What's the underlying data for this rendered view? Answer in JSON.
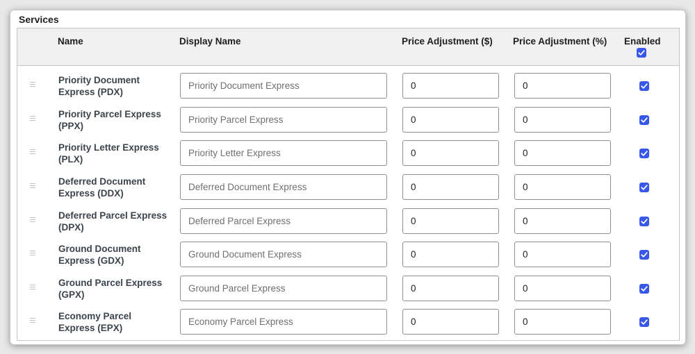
{
  "section": {
    "title": "Services"
  },
  "table": {
    "headers": {
      "name": "Name",
      "display_name": "Display Name",
      "price_adjustment": "Price Adjustment ($)",
      "price_adjustment_pct": "Price Adjustment (%)",
      "enabled": "Enabled"
    },
    "header_enabled_checked": true,
    "rows": [
      {
        "name": "Priority Document Express (PDX)",
        "display_placeholder": "Priority Document Express",
        "price": "0",
        "percent": "0",
        "enabled": true
      },
      {
        "name": "Priority Parcel Express (PPX)",
        "display_placeholder": "Priority Parcel Express",
        "price": "0",
        "percent": "0",
        "enabled": true
      },
      {
        "name": "Priority Letter Express (PLX)",
        "display_placeholder": "Priority Letter Express",
        "price": "0",
        "percent": "0",
        "enabled": true
      },
      {
        "name": "Deferred Document Express (DDX)",
        "display_placeholder": "Deferred Document Express",
        "price": "0",
        "percent": "0",
        "enabled": true
      },
      {
        "name": "Deferred Parcel Express (DPX)",
        "display_placeholder": "Deferred Parcel Express",
        "price": "0",
        "percent": "0",
        "enabled": true
      },
      {
        "name": "Ground Document Express (GDX)",
        "display_placeholder": "Ground Document Express",
        "price": "0",
        "percent": "0",
        "enabled": true
      },
      {
        "name": "Ground Parcel Express (GPX)",
        "display_placeholder": "Ground Parcel Express",
        "price": "0",
        "percent": "0",
        "enabled": true
      },
      {
        "name": "Economy Parcel Express (EPX)",
        "display_placeholder": "Economy Parcel Express",
        "price": "0",
        "percent": "0",
        "enabled": true
      }
    ]
  },
  "icons": {
    "drag_handle": "drag-handle-icon",
    "checkmark": "checkmark-icon"
  },
  "colors": {
    "checkbox": "#3858e9",
    "border": "#c3c4c7",
    "header_bg": "#f0f0f1"
  }
}
